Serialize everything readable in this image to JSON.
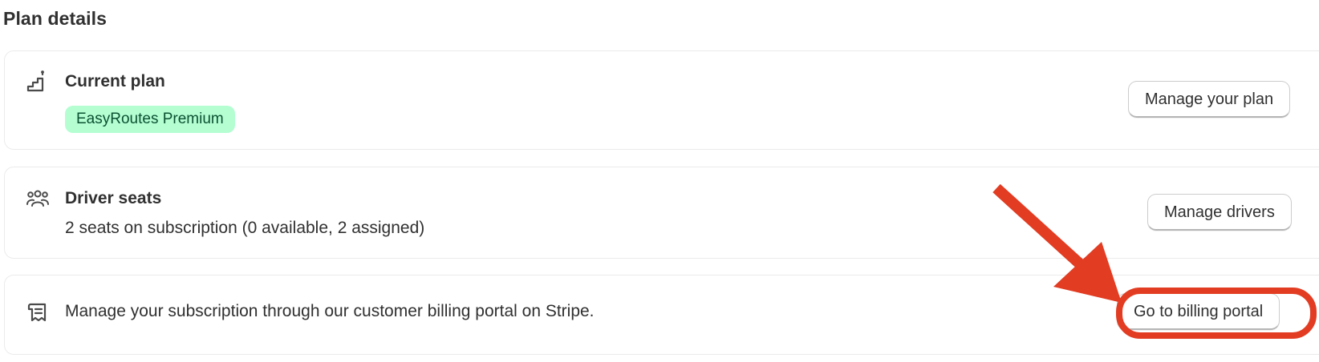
{
  "page": {
    "section_title": "Plan details"
  },
  "current_plan": {
    "heading": "Current plan",
    "badge": "EasyRoutes Premium",
    "button_label": "Manage your plan",
    "icon": "stairs-icon"
  },
  "driver_seats": {
    "heading": "Driver seats",
    "description": "2 seats on subscription (0 available, 2 assigned)",
    "button_label": "Manage drivers",
    "icon": "people-icon"
  },
  "billing": {
    "description": "Manage your subscription through our customer billing portal on Stripe.",
    "button_label": "Go to billing portal",
    "icon": "receipt-icon"
  },
  "annotation": {
    "color": "#e23c22",
    "target": "billing-portal-button"
  },
  "colors": {
    "badge_bg": "#b4fed2",
    "badge_text": "#0c5132",
    "text": "#303030"
  }
}
